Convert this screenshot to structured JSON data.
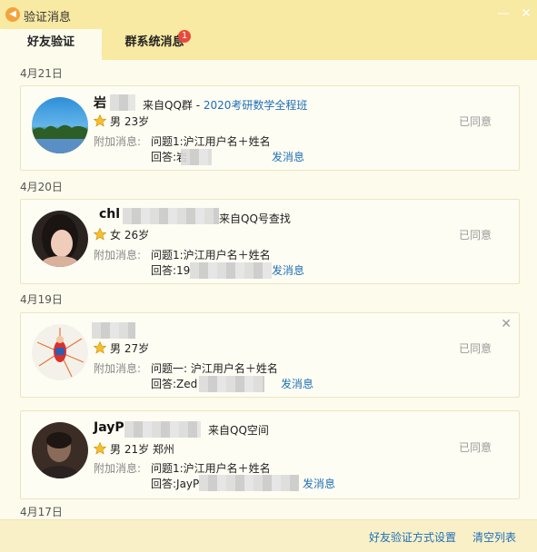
{
  "window": {
    "title": "验证消息",
    "icon": "speaker-icon"
  },
  "tabs": [
    {
      "label": "好友验证"
    },
    {
      "label": "群系统消息",
      "badge": "1"
    }
  ],
  "colors": {
    "accent": "#f8e9a3",
    "link": "#1e6fb8",
    "badge": "#e84a3a",
    "status": "#999999"
  },
  "groups": [
    {
      "date": "4月21日"
    },
    {
      "date": "4月20日"
    },
    {
      "date": "4月19日"
    },
    {
      "date": "4月17日"
    }
  ],
  "requests": [
    {
      "nickname": "岩",
      "source": "来自QQ群 - ",
      "source_link": "2020考研数学全程班",
      "gender_age": "男 23岁",
      "extra_label": "附加消息:",
      "question": "问题1:沪江用户名＋姓名",
      "answer": "回答:岩",
      "send_msg": "发消息",
      "status": "已同意"
    },
    {
      "nickname": "chl",
      "source": "来自QQ号查找",
      "source_link": "",
      "gender_age": "女 26岁",
      "extra_label": "附加消息:",
      "question": "问题1:沪江用户名＋姓名",
      "answer": "回答:19",
      "send_msg": "发消息",
      "status": "已同意"
    },
    {
      "nickname": "",
      "source": "",
      "source_link": "",
      "gender_age": "男 27岁",
      "extra_label": "附加消息:",
      "question": "问题一: 沪江用户名＋姓名",
      "answer": "回答:Zed",
      "send_msg": "发消息",
      "status": "已同意"
    },
    {
      "nickname": "JayP",
      "source": "来自QQ空间",
      "source_link": "",
      "gender_age": "男 21岁 郑州",
      "extra_label": "附加消息:",
      "question": "问题1:沪江用户名＋姓名",
      "answer": "回答:JayP",
      "send_msg": "发消息",
      "status": "已同意"
    }
  ],
  "footer": {
    "settings_link": "好友验证方式设置",
    "clear_link": "清空列表"
  }
}
